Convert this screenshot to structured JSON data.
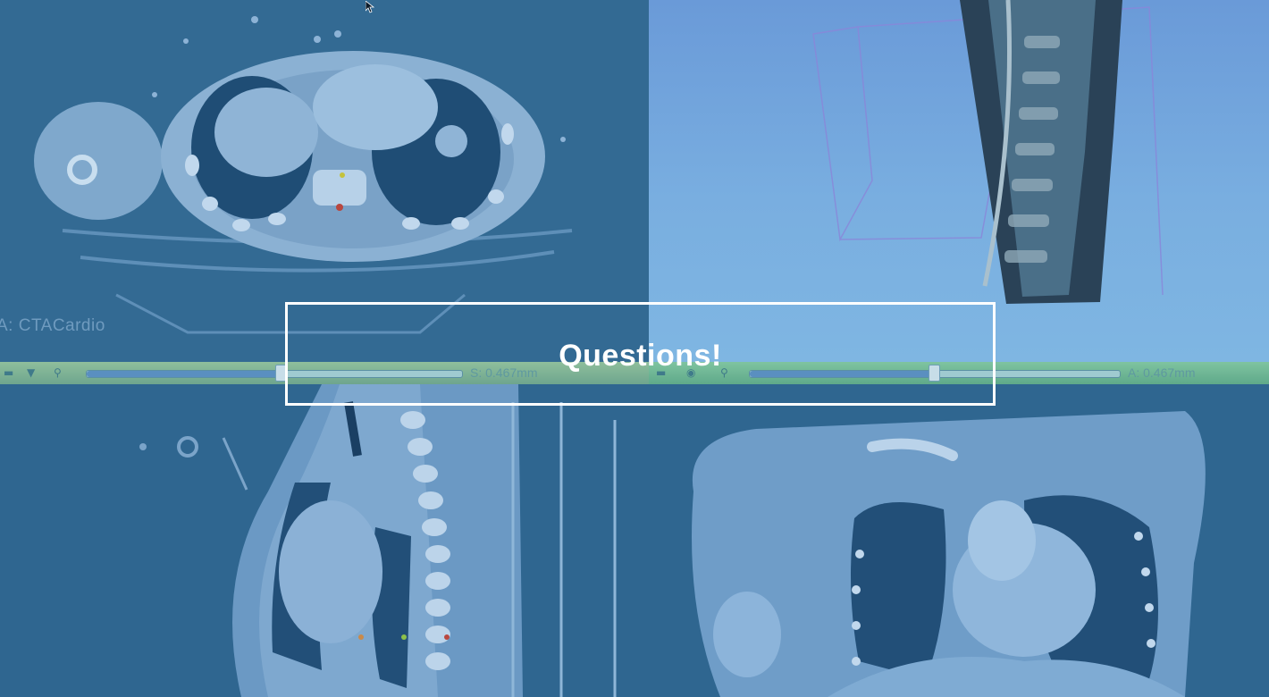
{
  "viewports": {
    "axial": {
      "label": "A: CTACardio"
    },
    "three_d": {},
    "sagittal": {},
    "coronal": {}
  },
  "slider_bar": {
    "left": {
      "readout": "S: 0.467mm",
      "position": 0.52
    },
    "right": {
      "readout": "A: 0.467mm",
      "position": 0.5
    }
  },
  "overlay": {
    "title": "Questions!"
  },
  "colors": {
    "overlay_border": "#ffffff",
    "slider_left": "#8fbf9c",
    "slider_right": "#7fc4a0",
    "background": "#2f6690"
  }
}
